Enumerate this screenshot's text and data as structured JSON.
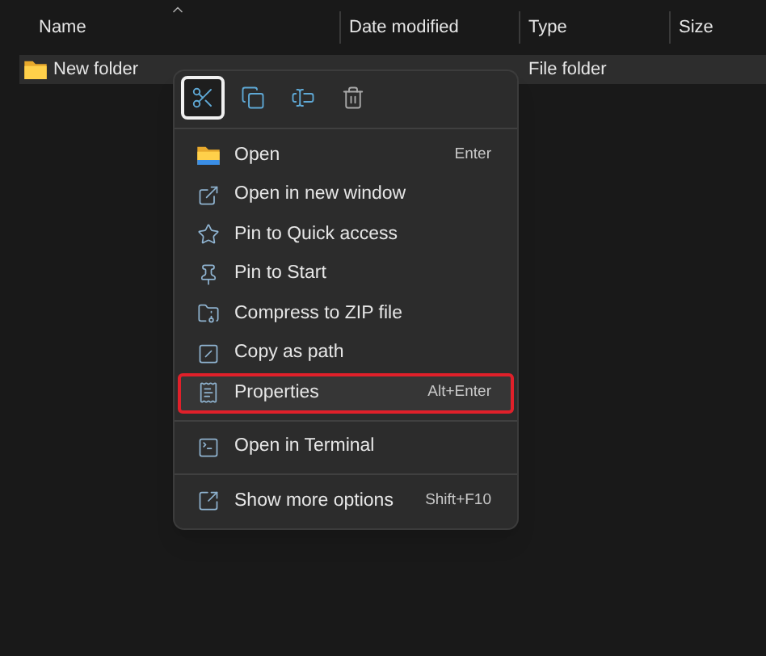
{
  "columns": [
    {
      "label": "Name",
      "sorted": true
    },
    {
      "label": "Date modified",
      "sorted": false
    },
    {
      "label": "Type",
      "sorted": false
    },
    {
      "label": "Size",
      "sorted": false
    }
  ],
  "rows": [
    {
      "name": "New folder",
      "type": "File folder",
      "selected": true
    }
  ],
  "context_menu": {
    "toolbar": [
      {
        "selected": true
      },
      {
        "selected": false
      },
      {
        "selected": false
      },
      {
        "selected": false
      }
    ],
    "groups": [
      [
        {
          "label": "Open",
          "shortcut": "Enter",
          "highlighted": false
        },
        {
          "label": "Open in new window",
          "highlighted": false
        },
        {
          "label": "Pin to Quick access",
          "highlighted": false
        },
        {
          "label": "Pin to Start",
          "highlighted": false
        },
        {
          "label": "Compress to ZIP file",
          "highlighted": false
        },
        {
          "label": "Copy as path",
          "highlighted": false
        },
        {
          "label": "Properties",
          "shortcut": "Alt+Enter",
          "highlighted": true
        }
      ],
      [
        {
          "label": "Open in Terminal",
          "highlighted": false
        }
      ],
      [
        {
          "label": "Show more options",
          "shortcut": "Shift+F10",
          "highlighted": false
        }
      ]
    ]
  }
}
